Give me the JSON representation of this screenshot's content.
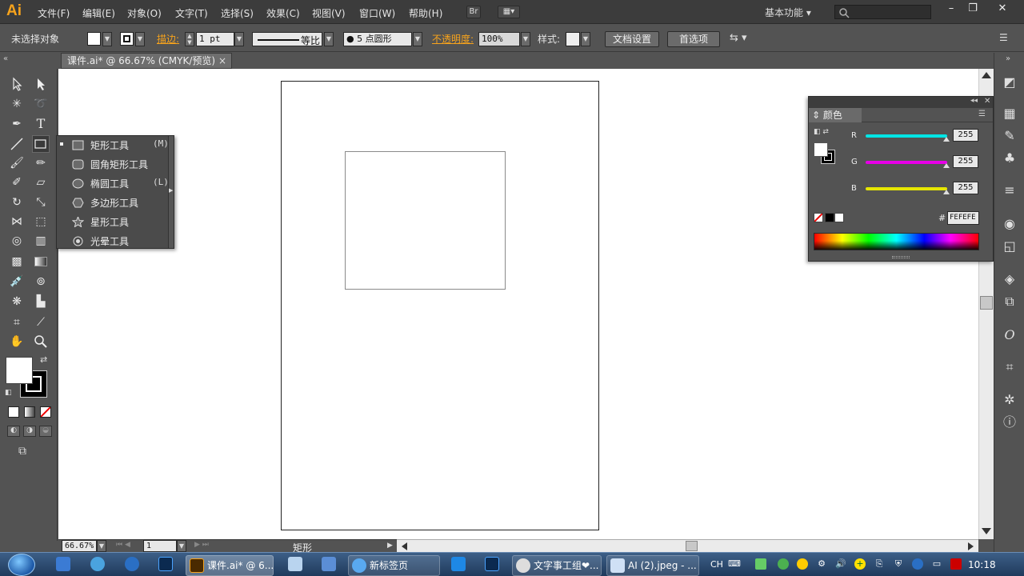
{
  "app": {
    "logo": "Ai",
    "workspace": "基本功能",
    "br_label": "Br"
  },
  "menu": [
    "文件(F)",
    "编辑(E)",
    "对象(O)",
    "文字(T)",
    "选择(S)",
    "效果(C)",
    "视图(V)",
    "窗口(W)",
    "帮助(H)"
  ],
  "control_bar": {
    "selection_label": "未选择对象",
    "stroke_label": "描边:",
    "stroke_weight": "1 pt",
    "stroke_profile": "等比",
    "brush": "5 点圆形",
    "opacity_label": "不透明度:",
    "opacity_value": "100%",
    "style_label": "样式:",
    "doc_setup": "文档设置",
    "preferences": "首选项"
  },
  "document_tab": {
    "title": "课件.ai* @ 66.67% (CMYK/预览)",
    "close": "×"
  },
  "flyout": {
    "items": [
      {
        "label": "矩形工具",
        "shortcut": "(M)",
        "icon": "rectangle-icon"
      },
      {
        "label": "圆角矩形工具",
        "shortcut": "",
        "icon": "rounded-rectangle-icon"
      },
      {
        "label": "椭圆工具",
        "shortcut": "(L)",
        "icon": "ellipse-icon"
      },
      {
        "label": "多边形工具",
        "shortcut": "",
        "icon": "polygon-icon"
      },
      {
        "label": "星形工具",
        "shortcut": "",
        "icon": "star-icon"
      },
      {
        "label": "光晕工具",
        "shortcut": "",
        "icon": "flare-icon"
      }
    ]
  },
  "color_panel": {
    "title": "颜色",
    "r_label": "R",
    "g_label": "G",
    "b_label": "B",
    "r_value": "255",
    "g_value": "255",
    "b_value": "255",
    "hex_label": "#",
    "hex_value": "FEFEFE",
    "r_track": "#00e5e5",
    "g_track": "#e600e6",
    "b_track": "#e6e600"
  },
  "status": {
    "zoom": "66.67%",
    "artboard": "1",
    "tool_name": "矩形"
  },
  "taskbar": {
    "buttons": [
      {
        "label": "课件.ai* @ 6..."
      },
      {
        "label": "新标签页"
      },
      {
        "label": "文字事工组❤..."
      },
      {
        "label": "AI (2).jpeg - ..."
      }
    ],
    "lang": "CH",
    "time": "10:18"
  },
  "colors": {
    "accent_orange": "#f7a31c",
    "panel_bg": "#535353",
    "menubar_bg": "#3c3c3c"
  }
}
